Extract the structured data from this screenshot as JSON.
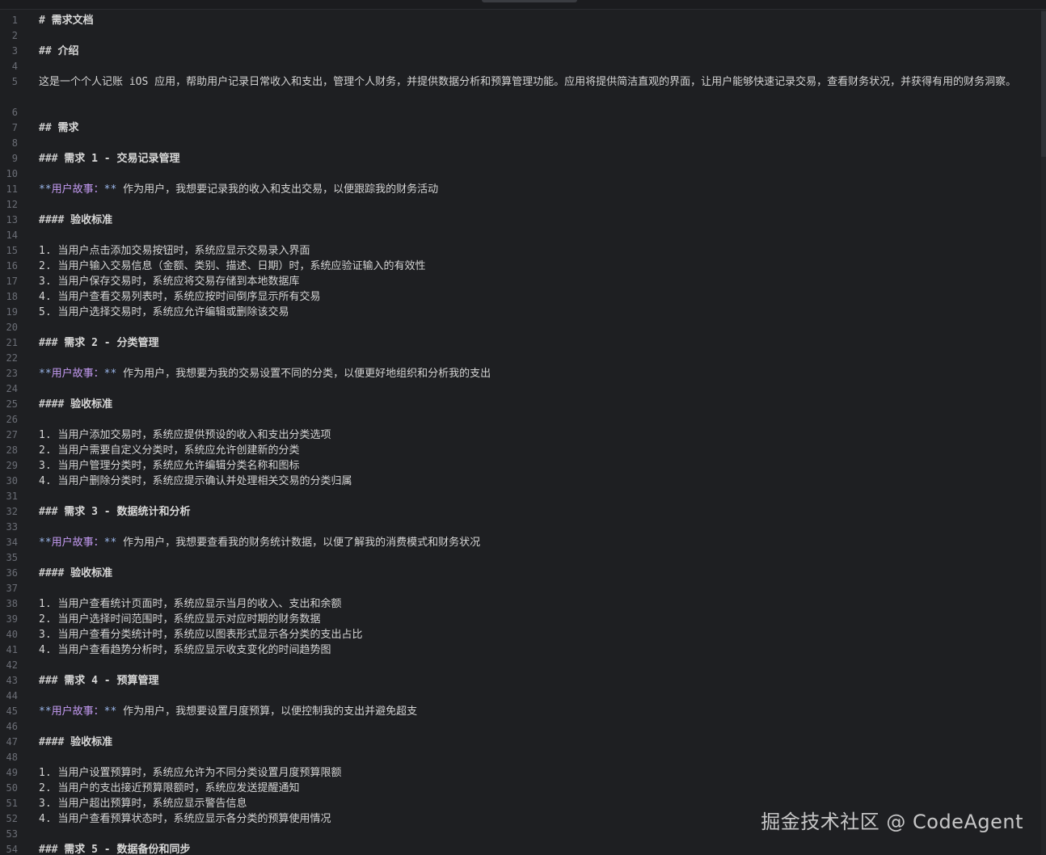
{
  "lines": [
    {
      "n": "1",
      "type": "h",
      "hash": "#",
      "text": " 需求文档"
    },
    {
      "n": "2",
      "type": "blank"
    },
    {
      "n": "3",
      "type": "h",
      "hash": "##",
      "text": " 介绍"
    },
    {
      "n": "4",
      "type": "blank"
    },
    {
      "n": "5",
      "type": "wrap",
      "text": "这是一个个人记账 iOS 应用，帮助用户记录日常收入和支出，管理个人财务，并提供数据分析和预算管理功能。应用将提供简洁直观的界面，让用户能够快速记录交易，查看财务状况，并获得有用的财务洞察。"
    },
    {
      "n": "6",
      "type": "blank"
    },
    {
      "n": "7",
      "type": "h",
      "hash": "##",
      "text": " 需求"
    },
    {
      "n": "8",
      "type": "blank"
    },
    {
      "n": "9",
      "type": "h",
      "hash": "###",
      "text": " 需求 1 - 交易记录管理"
    },
    {
      "n": "10",
      "type": "blank"
    },
    {
      "n": "11",
      "type": "story",
      "stars1": "**",
      "label": "用户故事：",
      "stars2": "**",
      "text": " 作为用户，我想要记录我的收入和支出交易，以便跟踪我的财务活动"
    },
    {
      "n": "12",
      "type": "blank"
    },
    {
      "n": "13",
      "type": "h",
      "hash": "####",
      "text": " 验收标准"
    },
    {
      "n": "14",
      "type": "blank"
    },
    {
      "n": "15",
      "type": "text",
      "text": "1. 当用户点击添加交易按钮时，系统应显示交易录入界面"
    },
    {
      "n": "16",
      "type": "text",
      "text": "2. 当用户输入交易信息（金额、类别、描述、日期）时，系统应验证输入的有效性"
    },
    {
      "n": "17",
      "type": "text",
      "text": "3. 当用户保存交易时，系统应将交易存储到本地数据库"
    },
    {
      "n": "18",
      "type": "text",
      "text": "4. 当用户查看交易列表时，系统应按时间倒序显示所有交易"
    },
    {
      "n": "19",
      "type": "text",
      "text": "5. 当用户选择交易时，系统应允许编辑或删除该交易"
    },
    {
      "n": "20",
      "type": "blank"
    },
    {
      "n": "21",
      "type": "h",
      "hash": "###",
      "text": " 需求 2 - 分类管理"
    },
    {
      "n": "22",
      "type": "blank"
    },
    {
      "n": "23",
      "type": "story",
      "stars1": "**",
      "label": "用户故事：",
      "stars2": "**",
      "text": " 作为用户，我想要为我的交易设置不同的分类，以便更好地组织和分析我的支出"
    },
    {
      "n": "24",
      "type": "blank"
    },
    {
      "n": "25",
      "type": "h",
      "hash": "####",
      "text": " 验收标准"
    },
    {
      "n": "26",
      "type": "blank"
    },
    {
      "n": "27",
      "type": "text",
      "text": "1. 当用户添加交易时，系统应提供预设的收入和支出分类选项"
    },
    {
      "n": "28",
      "type": "text",
      "text": "2. 当用户需要自定义分类时，系统应允许创建新的分类"
    },
    {
      "n": "29",
      "type": "text",
      "text": "3. 当用户管理分类时，系统应允许编辑分类名称和图标"
    },
    {
      "n": "30",
      "type": "text",
      "text": "4. 当用户删除分类时，系统应提示确认并处理相关交易的分类归属"
    },
    {
      "n": "31",
      "type": "blank"
    },
    {
      "n": "32",
      "type": "h",
      "hash": "###",
      "text": " 需求 3 - 数据统计和分析"
    },
    {
      "n": "33",
      "type": "blank"
    },
    {
      "n": "34",
      "type": "story",
      "stars1": "**",
      "label": "用户故事：",
      "stars2": "**",
      "text": " 作为用户，我想要查看我的财务统计数据，以便了解我的消费模式和财务状况"
    },
    {
      "n": "35",
      "type": "blank"
    },
    {
      "n": "36",
      "type": "h",
      "hash": "####",
      "text": " 验收标准"
    },
    {
      "n": "37",
      "type": "blank"
    },
    {
      "n": "38",
      "type": "text",
      "text": "1. 当用户查看统计页面时，系统应显示当月的收入、支出和余额"
    },
    {
      "n": "39",
      "type": "text",
      "text": "2. 当用户选择时间范围时，系统应显示对应时期的财务数据"
    },
    {
      "n": "40",
      "type": "text",
      "text": "3. 当用户查看分类统计时，系统应以图表形式显示各分类的支出占比"
    },
    {
      "n": "41",
      "type": "text",
      "text": "4. 当用户查看趋势分析时，系统应显示收支变化的时间趋势图"
    },
    {
      "n": "42",
      "type": "blank"
    },
    {
      "n": "43",
      "type": "h",
      "hash": "###",
      "text": " 需求 4 - 预算管理"
    },
    {
      "n": "44",
      "type": "blank"
    },
    {
      "n": "45",
      "type": "story",
      "stars1": "**",
      "label": "用户故事：",
      "stars2": "**",
      "text": " 作为用户，我想要设置月度预算，以便控制我的支出并避免超支"
    },
    {
      "n": "46",
      "type": "blank"
    },
    {
      "n": "47",
      "type": "h",
      "hash": "####",
      "text": " 验收标准"
    },
    {
      "n": "48",
      "type": "blank"
    },
    {
      "n": "49",
      "type": "text",
      "text": "1. 当用户设置预算时，系统应允许为不同分类设置月度预算限额"
    },
    {
      "n": "50",
      "type": "text",
      "text": "2. 当用户的支出接近预算限额时，系统应发送提醒通知"
    },
    {
      "n": "51",
      "type": "text",
      "text": "3. 当用户超出预算时，系统应显示警告信息"
    },
    {
      "n": "52",
      "type": "text",
      "text": "4. 当用户查看预算状态时，系统应显示各分类的预算使用情况"
    },
    {
      "n": "53",
      "type": "blank"
    },
    {
      "n": "54",
      "type": "h",
      "hash": "###",
      "text": " 需求 5 - 数据备份和同步"
    }
  ],
  "watermark": "掘金技术社区 @ CodeAgent"
}
